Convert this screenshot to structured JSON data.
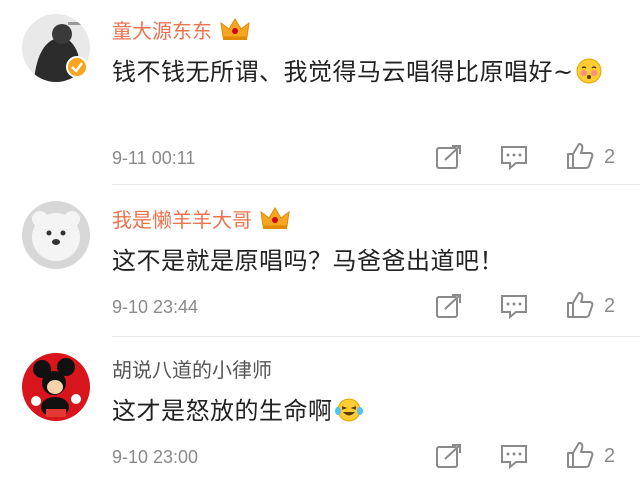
{
  "comments": [
    {
      "username": "童大源东东",
      "text": "钱不钱无所谓、我觉得马云唱得比原唱好~",
      "time": "9-11 00:11",
      "likes": "2",
      "vip_crown": true,
      "verified_badge": true,
      "emoji": "blushing-face"
    },
    {
      "username": "我是懒羊羊大哥",
      "text": "这不是就是原唱吗？马爸爸出道吧！",
      "time": "9-10 23:44",
      "likes": "2",
      "vip_crown": true,
      "verified_badge": false
    },
    {
      "username": "胡说八道的小律师",
      "text": "这才是怒放的生命啊",
      "time": "9-10 23:00",
      "likes": "2",
      "vip_crown": false,
      "verified_badge": false,
      "emoji": "laughing-tears-face"
    }
  ],
  "colors": {
    "vip_name": "#eb7350",
    "normal_name": "#555555",
    "meta_gray": "#8a8a8a",
    "crown_gold": "#f5a623"
  }
}
